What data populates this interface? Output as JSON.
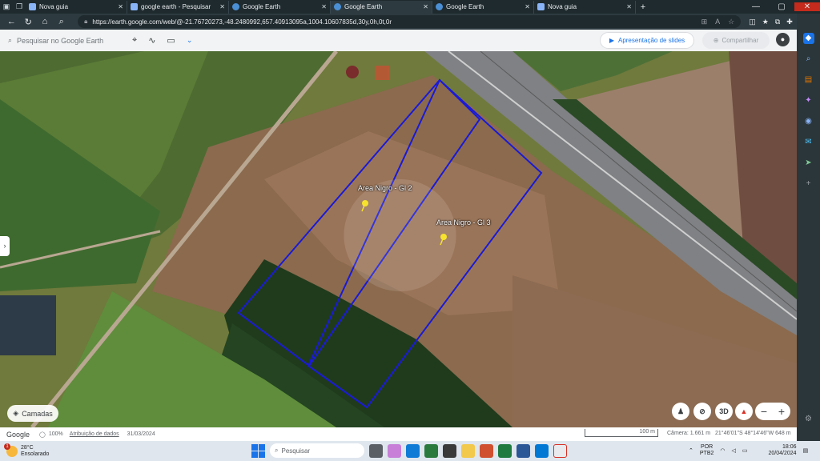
{
  "browser": {
    "tabs": [
      {
        "title": "Nova guia",
        "active": false
      },
      {
        "title": "google earth - Pesquisar",
        "active": false
      },
      {
        "title": "Google Earth",
        "active": false
      },
      {
        "title": "Google Earth",
        "active": true
      },
      {
        "title": "Google Earth",
        "active": false
      },
      {
        "title": "Nova guia",
        "active": false
      }
    ],
    "url": "https://earth.google.com/web/@-21.76720273,-48.2480992,657.40913095a,1004.10607835d,30y,0h,0t,0r"
  },
  "earth": {
    "search_placeholder": "Pesquisar no Google Earth",
    "slides_button": "Apresentação de slides",
    "share_button": "Compartilhar",
    "layers_button": "Camadas",
    "view_3d": "3D",
    "placemarks": [
      {
        "label": "Area Nigro - Gl 2"
      },
      {
        "label": "Area Nigro - Gl 3"
      }
    ],
    "polygon_color": "#1a1ad6",
    "pin_color": "#f7e32d"
  },
  "status": {
    "logo": "Google",
    "zoom_pct": "100%",
    "attribution": "Atribuição de dados",
    "imagery_date": "31/03/2024",
    "scale": "100 m",
    "camera": "Câmera: 1.661 m",
    "coords": "21°46'01\"S 48°14'46\"W  648 m"
  },
  "taskbar": {
    "temp": "28°C",
    "weather": "Ensolarado",
    "weather_badge": "1",
    "search": "Pesquisar",
    "lang1": "POR",
    "lang2": "PTB2",
    "time": "18:06",
    "date": "20/04/2024"
  }
}
